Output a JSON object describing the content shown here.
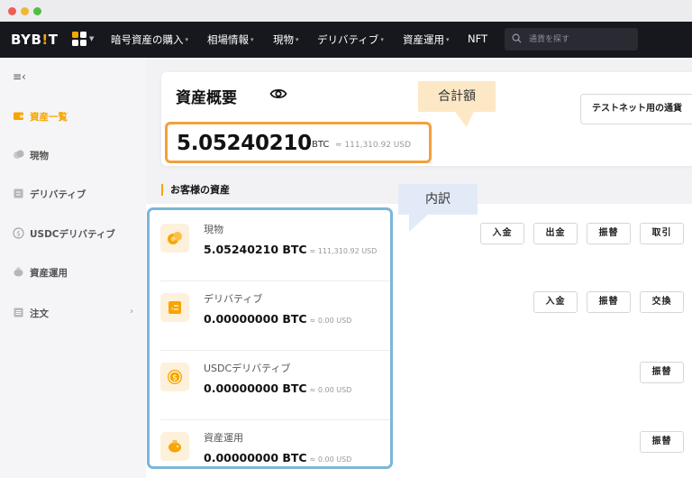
{
  "brand": {
    "logo_main": "BYB",
    "logo_accent": "!",
    "logo_end": "T",
    "accent_color": "#f7a600"
  },
  "topnav": {
    "items": [
      {
        "label": "暗号資産の購入",
        "caret": "▾"
      },
      {
        "label": "相場情報",
        "caret": "▾"
      },
      {
        "label": "現物",
        "caret": "▾"
      },
      {
        "label": "デリバティブ",
        "caret": "▾"
      },
      {
        "label": "資産運用",
        "caret": "▾"
      },
      {
        "label": "NFT",
        "caret": ""
      }
    ],
    "search_placeholder": "通貨を探す"
  },
  "sidebar": {
    "items": [
      {
        "label": "資産一覧",
        "icon": "wallet-icon",
        "active": true
      },
      {
        "label": "現物",
        "icon": "coins-icon"
      },
      {
        "label": "デリバティブ",
        "icon": "chart-doc-icon"
      },
      {
        "label": "USDCデリバティブ",
        "icon": "usdc-coin-icon"
      },
      {
        "label": "資産運用",
        "icon": "piggy-bank-icon"
      },
      {
        "label": "注文",
        "icon": "order-list-icon",
        "chevron": "›"
      }
    ]
  },
  "summary": {
    "title": "資産概要",
    "total_value": "5.05240210",
    "total_unit": "BTC",
    "total_usd": "≈ 111,310.92 USD",
    "testnet_button": "テストネット用の通貨"
  },
  "callouts": {
    "total": "合計額",
    "breakdown": "内訳"
  },
  "section_title": "お客様の資産",
  "assets": [
    {
      "name": "現物",
      "value": "5.05240210 BTC",
      "usd": "≈ 111,310.92 USD",
      "icon": "spot-coins-icon",
      "actions": [
        "入金",
        "出金",
        "振替",
        "取引"
      ]
    },
    {
      "name": "デリバティブ",
      "value": "0.00000000 BTC",
      "usd": "≈ 0.00 USD",
      "icon": "derivatives-doc-icon",
      "actions": [
        "入金",
        "振替",
        "交換"
      ]
    },
    {
      "name": "USDCデリバティブ",
      "value": "0.00000000 BTC",
      "usd": "≈ 0.00 USD",
      "icon": "usdc-icon",
      "actions": [
        "振替"
      ]
    },
    {
      "name": "資産運用",
      "value": "0.00000000 BTC",
      "usd": "≈ 0.00 USD",
      "icon": "piggy-icon",
      "actions": [
        "振替"
      ]
    }
  ]
}
